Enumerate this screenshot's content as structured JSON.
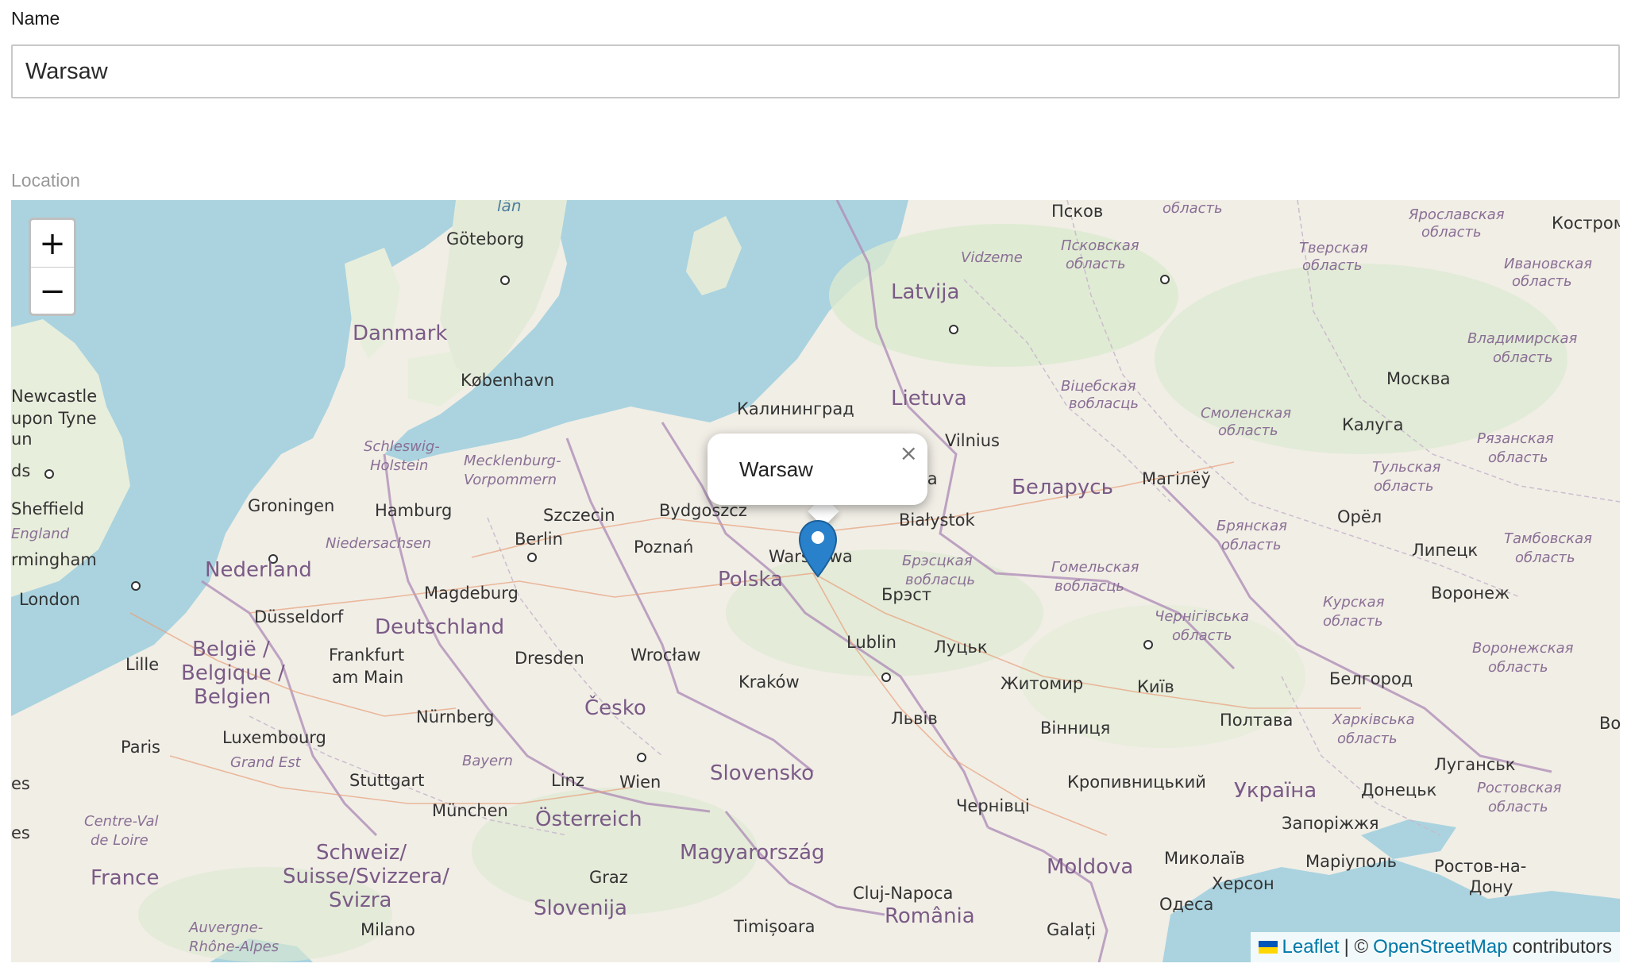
{
  "form": {
    "name_label": "Name",
    "name_value": "Warsaw",
    "location_label": "Location"
  },
  "map": {
    "zoom_in_label": "+",
    "zoom_out_label": "−",
    "popup_text": "Warsaw",
    "popup_close": "×",
    "attribution": {
      "leaflet": "Leaflet",
      "separator": "| ©",
      "osm": "OpenStreetMap",
      "suffix": "contributors"
    },
    "labels": {
      "pskov": "Псков",
      "oblast_top": "область",
      "yaroslavl": "Ярославская",
      "yaroslavl2": "область",
      "kostroma": "Кострома",
      "goteborg": "Göteborg",
      "danmark": "Danmark",
      "kobenhavn": "København",
      "latvija": "Latvija",
      "vidzeme": "Vidzeme",
      "pskov_obl1": "Псковская",
      "pskov_obl2": "область",
      "tver1": "Тверская",
      "tver2": "область",
      "ivanovo1": "Ивановская",
      "ivanovo2": "область",
      "vladimir1": "Владимирская",
      "vladimir2": "область",
      "moskva": "Москва",
      "newcastle1": "Newcastle",
      "newcastle2": "upon Tyne",
      "lietuva": "Lietuva",
      "kaliningrad": "Калининград",
      "vitebsk1": "Віцебская",
      "vitebsk2": "вобласць",
      "smolensk1": "Смоленская",
      "smolensk2": "область",
      "kaluga": "Калуга",
      "ryazan1": "Рязанская",
      "ryazan2": "область",
      "vilnius": "Vilnius",
      "schleswig1": "Schleswig-",
      "schleswig2": "Holstein",
      "mecklenburg1": "Mecklenburg-",
      "mecklenburg2": "Vorpommern",
      "tula1": "Тульская",
      "tula2": "область",
      "mogilev": "Магілёў",
      "belarus": "Беларусь",
      "na": "на",
      "sheffield": "Sheffield",
      "groningen": "Groningen",
      "hamburg": "Hamburg",
      "szczecin": "Szczecin",
      "bydgoszcz": "Bydgoszcz",
      "bialystok": "Białystok",
      "orel": "Орёл",
      "bryansk1": "Брянская",
      "bryansk2": "область",
      "tambov1": "Тамбовская",
      "tambov2": "область",
      "england": "England",
      "niedersachsen": "Niedersachsen",
      "berlin": "Berlin",
      "poznan": "Poznań",
      "warszawa": "Warszawa",
      "brest1": "Брэсцкая",
      "brest2": "вобласць",
      "gomel1": "Гомельская",
      "gomel2": "вобласць",
      "lipetsk": "Липецк",
      "birmingham": "rmingham",
      "nederland": "Nederland",
      "polska": "Polska",
      "brest_city": "Брэст",
      "kursk1": "Курская",
      "kursk2": "область",
      "voronezh": "Воронеж",
      "chernigov1": "Чернігівська",
      "chernigov2": "область",
      "london": "London",
      "magdeburg": "Magdeburg",
      "dusseldorf": "Düsseldorf",
      "deutschland": "Deutschland",
      "lublin": "Lublin",
      "lutsk": "Луцьк",
      "voronezh_obl1": "Воронежская",
      "voronezh_obl2": "область",
      "lille": "Lille",
      "belgie1": "België /",
      "belgie2": "Belgique /",
      "belgie3": "Belgien",
      "frankfurt1": "Frankfurt",
      "frankfurt2": "am Main",
      "dresden": "Dresden",
      "wroclaw": "Wrocław",
      "krakow": "Kraków",
      "zhytomyr": "Житомир",
      "kyiv": "Київ",
      "belgorod": "Белгород",
      "cesko": "Česko",
      "nurnberg": "Nürnberg",
      "lviv": "Львів",
      "vinnytsia": "Вінниця",
      "poltava": "Полтава",
      "kharkiv1": "Харківська",
      "kharkiv2": "область",
      "luxembourg": "Luxembourg",
      "paris": "Paris",
      "grand_est": "Grand Est",
      "bayern": "Bayern",
      "slovensko": "Slovensko",
      "luhansk": "Луганськ",
      "stuttgart": "Stuttgart",
      "linz": "Linz",
      "wien": "Wien",
      "kropyvnytskyi": "Кропивницький",
      "ukraina": "Україна",
      "donetsk": "Донецьк",
      "rostov_obl1": "Ростовская",
      "rostov_obl2": "область",
      "centre1": "Centre-Val",
      "centre2": "de Loire",
      "munchen": "München",
      "osterreich": "Österreich",
      "chernivtsi": "Чернівці",
      "zaporizhzhia": "Запоріжжя",
      "schweiz1": "Schweiz/",
      "schweiz2": "Suisse/Svizzera/",
      "schweiz3": "Svizra",
      "magyarorszag": "Magyarország",
      "moldova": "Moldova",
      "mykolaiv": "Миколаїв",
      "mariupol": "Маріуполь",
      "rostov1": "Ростов-на-",
      "rostov2": "Дону",
      "france": "France",
      "graz": "Graz",
      "kherson": "Херсон",
      "cluj": "Cluj-Napoca",
      "odesa": "Одеса",
      "slovenija": "Slovenija",
      "romania": "România",
      "auvergne": "Auvergne-",
      "rhone": "Rhône-Alpes",
      "milano": "Milano",
      "timisoara": "Timișoara",
      "galati": "Galați",
      "lan": "län",
      "es1": "es",
      "es2": "es",
      "ds": "ds",
      "un": "un",
      "bo": "Bo"
    }
  }
}
